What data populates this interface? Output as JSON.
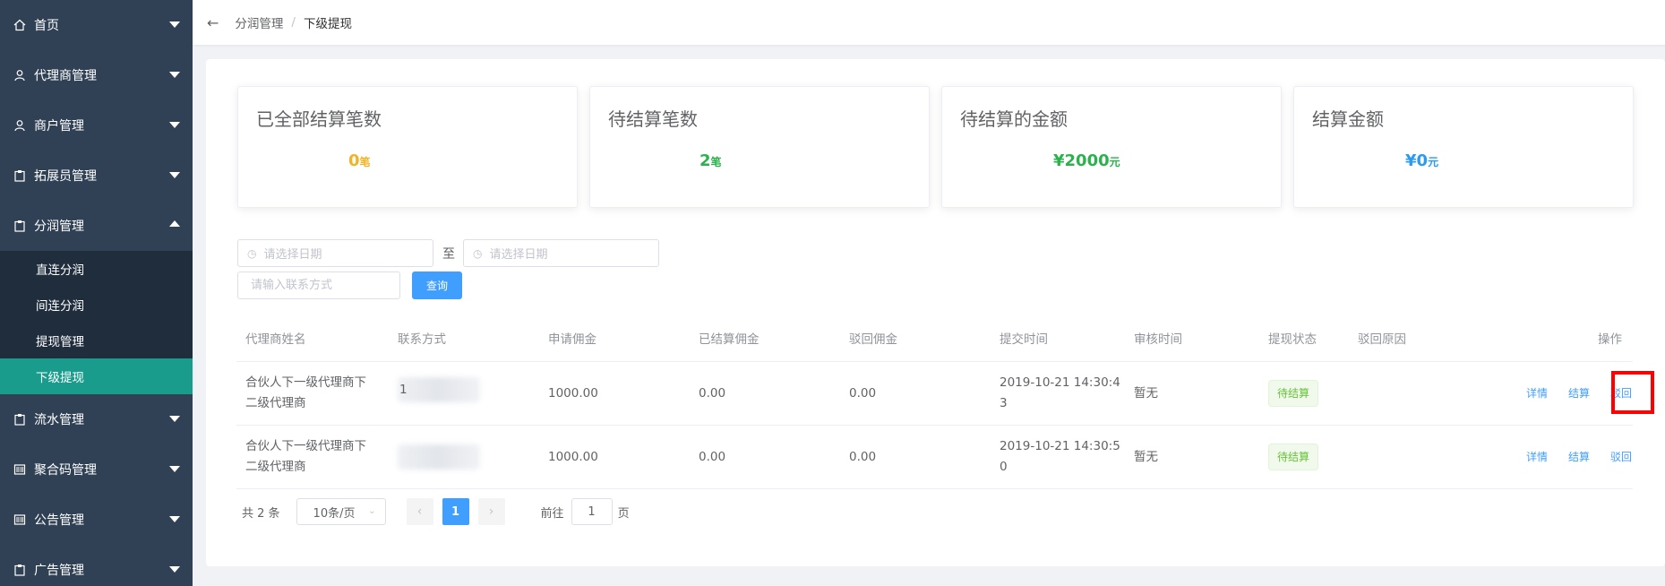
{
  "sidebar": {
    "items": [
      {
        "label": "首页",
        "icon": "home-icon"
      },
      {
        "label": "代理商管理",
        "icon": "user-icon"
      },
      {
        "label": "商户管理",
        "icon": "user-icon"
      },
      {
        "label": "拓展员管理",
        "icon": "clipboard-icon"
      },
      {
        "label": "分润管理",
        "icon": "clipboard-icon",
        "expanded": true
      },
      {
        "label": "流水管理",
        "icon": "clipboard-icon"
      },
      {
        "label": "聚合码管理",
        "icon": "barcode-icon"
      },
      {
        "label": "公告管理",
        "icon": "barcode-icon"
      },
      {
        "label": "广告管理",
        "icon": "clipboard-icon"
      }
    ],
    "submenu": [
      {
        "label": "直连分润"
      },
      {
        "label": "间连分润"
      },
      {
        "label": "提现管理"
      },
      {
        "label": "下级提现",
        "active": true
      }
    ]
  },
  "header": {
    "breadcrumb": [
      "分润管理",
      "下级提现"
    ],
    "separator": "/"
  },
  "stats": [
    {
      "title": "已全部结算笔数",
      "value": "0",
      "unit": "笔",
      "color": "#f0b429"
    },
    {
      "title": "待结算笔数",
      "value": "2",
      "unit": "笔",
      "color": "#2bb24c"
    },
    {
      "title": "待结算的金额",
      "value": "¥2000",
      "unit": "元",
      "color": "#2bb24c"
    },
    {
      "title": "结算金额",
      "value": "¥0",
      "unit": "元",
      "color": "#2b9af3"
    }
  ],
  "filters": {
    "start_date_placeholder": "请选择日期",
    "to_label": "至",
    "end_date_placeholder": "请选择日期",
    "contact_placeholder": "请输入联系方式",
    "query_button": "查询"
  },
  "table": {
    "columns": [
      "代理商姓名",
      "联系方式",
      "申请佣金",
      "已结算佣金",
      "驳回佣金",
      "提交时间",
      "审核时间",
      "提现状态",
      "驳回原因",
      "操作"
    ],
    "rows": [
      {
        "name_line1": "合伙人下一级代理商下",
        "name_line2": "二级代理商",
        "contact": "1",
        "apply": "1000.00",
        "settled": "0.00",
        "rejected": "0.00",
        "submit_line1": "2019-10-21 14:30:4",
        "submit_line2": "3",
        "audit": "暂无",
        "status": "待结算",
        "reason": "",
        "actions": [
          "详情",
          "结算",
          "驳回"
        ]
      },
      {
        "name_line1": "合伙人下一级代理商下",
        "name_line2": "二级代理商",
        "contact": "",
        "apply": "1000.00",
        "settled": "0.00",
        "rejected": "0.00",
        "submit_line1": "2019-10-21 14:30:5",
        "submit_line2": "0",
        "audit": "暂无",
        "status": "待结算",
        "reason": "",
        "actions": [
          "详情",
          "结算",
          "驳回"
        ]
      }
    ]
  },
  "pagination": {
    "total": "共 2 条",
    "page_size": "10条/页",
    "current_page": "1",
    "goto_label": "前往",
    "goto_value": "1",
    "page_suffix": "页"
  },
  "colors": {
    "sidebar_bg": "#304156",
    "submenu_bg": "#1f2d3d",
    "active_item": "#1a9c8c",
    "primary": "#409eff",
    "highlight": "#ff0000"
  }
}
